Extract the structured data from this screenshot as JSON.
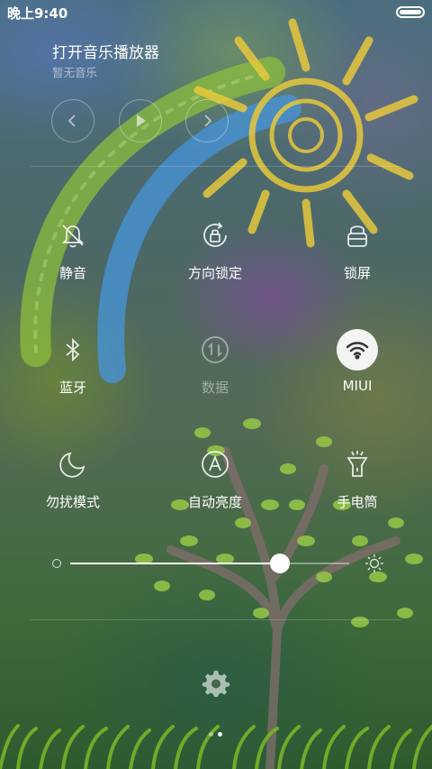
{
  "status": {
    "time": "晚上9:40"
  },
  "music": {
    "title": "打开音乐播放器",
    "subtitle": "暂无音乐"
  },
  "toggles": [
    {
      "label": "静音",
      "icon": "bell-muted-icon",
      "state": "off"
    },
    {
      "label": "方向锁定",
      "icon": "rotation-lock-icon",
      "state": "off"
    },
    {
      "label": "锁屏",
      "icon": "lock-icon",
      "state": "off"
    },
    {
      "label": "蓝牙",
      "icon": "bluetooth-icon",
      "state": "off"
    },
    {
      "label": "数据",
      "icon": "mobile-data-icon",
      "state": "disabled"
    },
    {
      "label": "MIUI",
      "icon": "wifi-icon",
      "state": "on"
    },
    {
      "label": "勿扰模式",
      "icon": "moon-icon",
      "state": "off"
    },
    {
      "label": "自动亮度",
      "icon": "auto-brightness-icon",
      "state": "off"
    },
    {
      "label": "手电筒",
      "icon": "flashlight-icon",
      "state": "off"
    }
  ],
  "brightness": {
    "level": 0.75
  },
  "pager": {
    "count": 2,
    "active": 1
  },
  "colors": {
    "active_toggle_bg": "#f4f4f4"
  }
}
